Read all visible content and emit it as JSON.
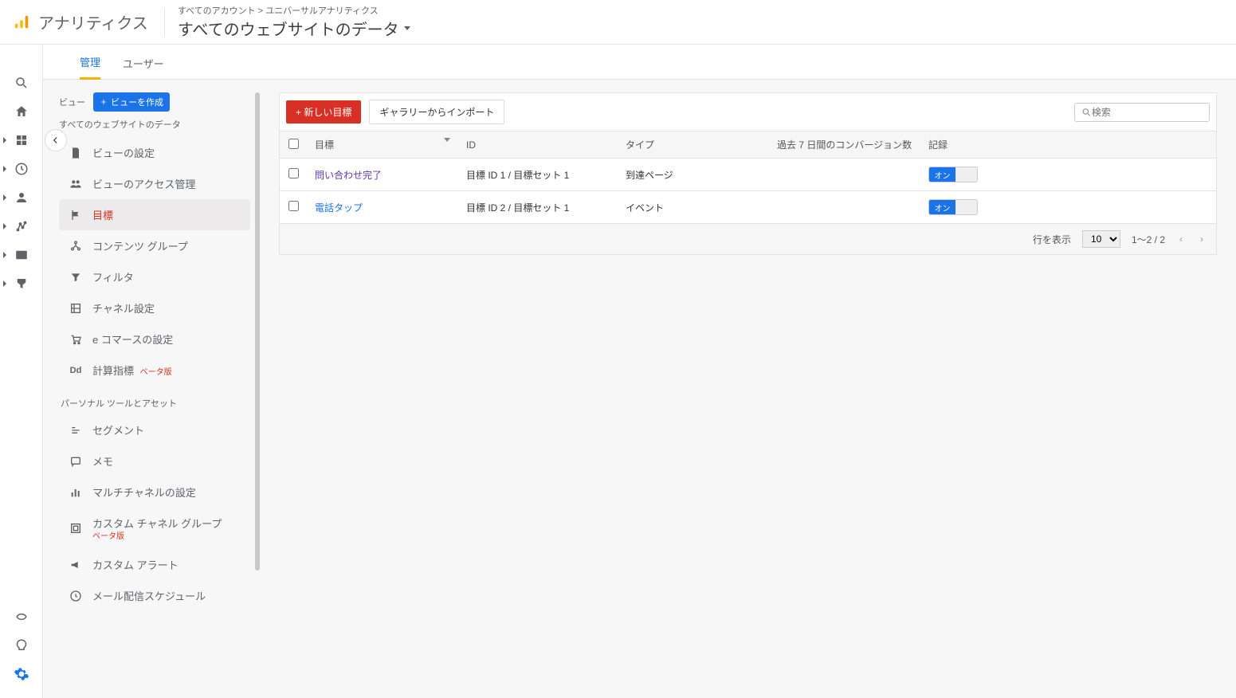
{
  "header": {
    "app_name": "アナリティクス",
    "breadcrumb": "すべてのアカウント > ユニバーサルアナリティクス",
    "view_name": "すべてのウェブサイトのデータ"
  },
  "tabs": {
    "admin": "管理",
    "user": "ユーザー"
  },
  "viewcol": {
    "label": "ビュー",
    "create": "ビューを作成",
    "current": "すべてのウェブサイトのデータ",
    "items": {
      "settings": "ビューの設定",
      "access": "ビューのアクセス管理",
      "goals": "目標",
      "content_groups": "コンテンツ グループ",
      "filters": "フィルタ",
      "channels": "チャネル設定",
      "ecommerce": "e コマースの設定",
      "calc": "計算指標",
      "calc_beta": "ベータ版"
    },
    "section": "パーソナル ツールとアセット",
    "personal": {
      "segments": "セグメント",
      "memo": "メモ",
      "multichannel": "マルチチャネルの設定",
      "custom_channel": "カスタム チャネル グループ",
      "custom_channel_beta": "ベータ版",
      "custom_alert": "カスタム アラート",
      "mail_schedule": "メール配信スケジュール"
    }
  },
  "toolbar": {
    "new_goal": "+ 新しい目標",
    "import": "ギャラリーからインポート",
    "search_placeholder": "検索"
  },
  "table": {
    "cols": {
      "goal": "目標",
      "id": "ID",
      "type": "タイプ",
      "conv": "過去 7 日間のコンバージョン数",
      "rec": "記録"
    },
    "rows": [
      {
        "name": "問い合わせ完了",
        "link_color": "purple",
        "id": "目標 ID 1 / 目標セット 1",
        "type": "到達ページ",
        "toggle": "オン"
      },
      {
        "name": "電話タップ",
        "link_color": "blue",
        "id": "目標 ID 2 / 目標セット 1",
        "type": "イベント",
        "toggle": "オン"
      }
    ]
  },
  "pager": {
    "rows_label": "行を表示",
    "page_size": "10",
    "range": "1～2 / 2"
  }
}
